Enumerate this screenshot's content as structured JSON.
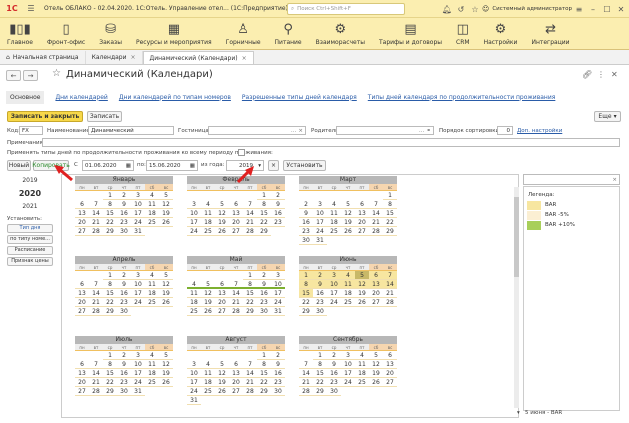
{
  "app": {
    "logo": "1С",
    "title": "Отель ОБЛАКО - 02.04.2020. 1С:Отель. Управление отел... (1С:Предприятие)",
    "search_placeholder": "Поиск Ctrl+Shift+F",
    "user": "Системный администратор"
  },
  "sections": [
    {
      "label": "Главное",
      "icon": "chart-bars-icon",
      "glyph": "▮▯▮"
    },
    {
      "label": "Фронт-офис",
      "icon": "door-icon",
      "glyph": "▯"
    },
    {
      "label": "Заказы",
      "icon": "shopping-bag-icon",
      "glyph": "⛁"
    },
    {
      "label": "Ресурсы и мероприятия",
      "icon": "calendar-icon",
      "glyph": "▦"
    },
    {
      "label": "Горничные",
      "icon": "maid-icon",
      "glyph": "♙"
    },
    {
      "label": "Питание",
      "icon": "fork-knife-icon",
      "glyph": "⚲"
    },
    {
      "label": "Взаиморасчеты",
      "icon": "settlements-icon",
      "glyph": "⚙"
    },
    {
      "label": "Тарифы и договоры",
      "icon": "contract-icon",
      "glyph": "▤"
    },
    {
      "label": "CRM",
      "icon": "crm-icon",
      "glyph": "◫"
    },
    {
      "label": "Настройки",
      "icon": "settings-icon",
      "glyph": "⚙"
    },
    {
      "label": "Интеграции",
      "icon": "integration-icon",
      "glyph": "⇄"
    }
  ],
  "open_tabs": [
    {
      "label": "Начальная страница"
    },
    {
      "label": "Календари"
    },
    {
      "label": "Динамический (Календари)"
    }
  ],
  "form": {
    "title": "Динамический (Календари)",
    "link_tabs": [
      "Основное",
      "Дни календарей",
      "Дни календарей по типам номеров",
      "Разрешенные типы дней календаря",
      "Типы дней календаря по продолжительности проживания"
    ],
    "btn_save_close": "Записать и закрыть",
    "btn_save": "Записать",
    "btn_more": "Еще",
    "code_label": "Код:",
    "code_value": "FX",
    "name_label": "Наименование:",
    "name_value": "Динамический",
    "hotel_label": "Гостиница:",
    "parent_label": "Родитель:",
    "sort_label": "Порядок сортировки:",
    "sort_value": "0",
    "sort_link": "Доп. настройки",
    "notes_label": "Примечания:",
    "apply_label": "Применять типы дней по продолжительности проживания ко всему периоду проживания:",
    "btn_new": "Новый",
    "btn_copy": "Копировать",
    "from_label": "С",
    "from_value": "01.06.2020",
    "to_label": "по:",
    "to_value": "15.06.2020",
    "fromyear_label": "из года:",
    "fromyear_value": "2019",
    "btn_set": "Установить"
  },
  "years": [
    "2019",
    "2020",
    "2021"
  ],
  "side": {
    "set_label": "Установить:",
    "buttons": [
      "Тип дня",
      "по типу номе...",
      "Расписание",
      "Признак цены"
    ]
  },
  "weekday_labels": [
    "пн",
    "вт",
    "ср",
    "чт",
    "пт",
    "сб",
    "вс"
  ],
  "months": [
    {
      "name": "Январь",
      "offset": 2,
      "days": 31
    },
    {
      "name": "Февраль",
      "offset": 5,
      "days": 29
    },
    {
      "name": "Март",
      "offset": 6,
      "days": 31
    },
    {
      "name": "Апрель",
      "offset": 2,
      "days": 30
    },
    {
      "name": "Май",
      "offset": 4,
      "days": 31
    },
    {
      "name": "Июнь",
      "offset": 0,
      "days": 30
    },
    {
      "name": "Июль",
      "offset": 2,
      "days": 31
    },
    {
      "name": "Август",
      "offset": 5,
      "days": 31
    },
    {
      "name": "Сентябрь",
      "offset": 1,
      "days": 30
    }
  ],
  "highlights": {
    "june_bar_days": [
      1,
      2,
      3,
      4,
      5,
      6,
      7,
      8,
      9,
      10,
      11,
      12,
      13,
      14,
      15
    ],
    "june_selected_day": 5,
    "may_green_days": [
      4,
      5,
      6,
      7,
      8,
      9,
      10
    ]
  },
  "legend": {
    "title": "Легенда:",
    "items": [
      {
        "label": "BAR",
        "color": "#f7e6a0"
      },
      {
        "label": "BAR -5%",
        "color": "#fbefd3"
      },
      {
        "label": "BAR +10%",
        "color": "#a8cf5a"
      }
    ],
    "footer": "5 июня - BAR"
  }
}
